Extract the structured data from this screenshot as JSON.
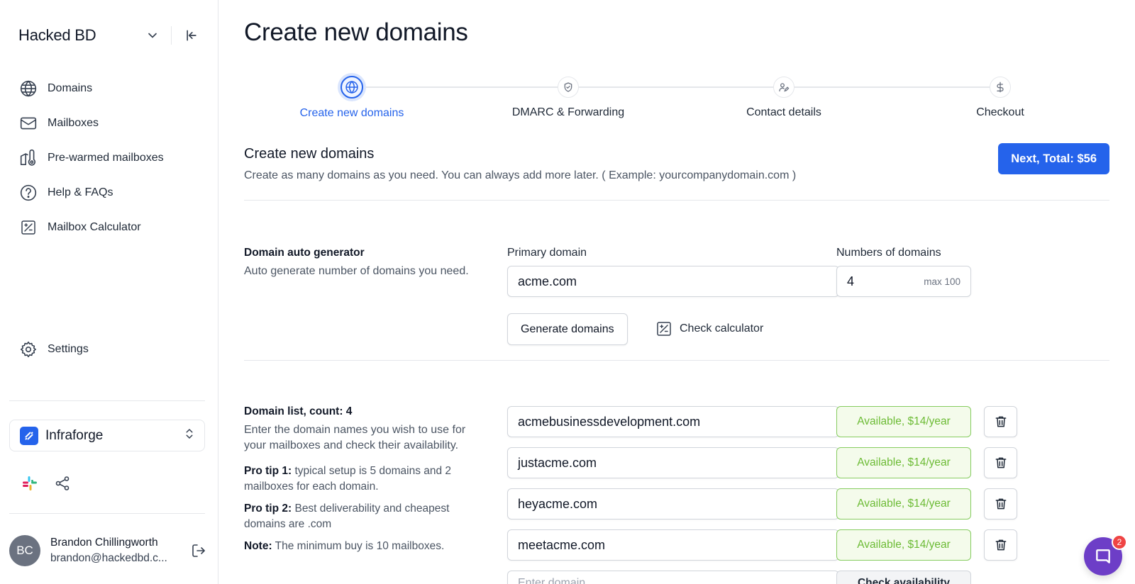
{
  "workspace": {
    "name": "Hacked BD"
  },
  "sidebar": {
    "items": [
      {
        "label": "Domains",
        "icon": "globe-icon"
      },
      {
        "label": "Mailboxes",
        "icon": "envelope-icon"
      },
      {
        "label": "Pre-warmed mailboxes",
        "icon": "thermometer-icon"
      },
      {
        "label": "Help & FAQs",
        "icon": "question-icon"
      },
      {
        "label": "Mailbox Calculator",
        "icon": "calculator-icon"
      }
    ],
    "settings_label": "Settings"
  },
  "org": {
    "name": "Infraforge"
  },
  "user": {
    "initials": "BC",
    "name": "Brandon Chillingworth",
    "email": "brandon@hackedbd.c..."
  },
  "page": {
    "title": "Create new domains"
  },
  "stepper": {
    "steps": [
      {
        "label": "Create new domains",
        "icon": "globe-icon",
        "active": true
      },
      {
        "label": "DMARC & Forwarding",
        "icon": "shield-check-icon",
        "active": false
      },
      {
        "label": "Contact details",
        "icon": "user-edit-icon",
        "active": false
      },
      {
        "label": "Checkout",
        "icon": "dollar-icon",
        "active": false
      }
    ]
  },
  "section": {
    "title": "Create new domains",
    "description": "Create as many domains as you need. You can always add more later. ( Example: yourcompanydomain.com )",
    "next_label": "Next, Total: $56"
  },
  "generator": {
    "title": "Domain auto generator",
    "description": "Auto generate number of domains you need.",
    "primary_label": "Primary domain",
    "primary_value": "acme.com",
    "count_label": "Numbers of domains",
    "count_value": "4",
    "count_suffix": "max 100",
    "generate_label": "Generate domains",
    "calculator_label": "Check calculator"
  },
  "domain_list": {
    "title": "Domain list, count: 4",
    "description": "Enter the domain names you wish to use for your mailboxes and check their availability.",
    "tip1_label": "Pro tip 1:",
    "tip1_text": " typical setup is 5 domains and 2 mailboxes for each domain.",
    "tip2_label": "Pro tip 2:",
    "tip2_text": " Best deliverability and cheapest domains are .com",
    "note_label": "Note:",
    "note_text": " The minimum buy is 10 mailboxes.",
    "rows": [
      {
        "domain": "acmebusinessdevelopment.com",
        "status": "Available, $14/year"
      },
      {
        "domain": "justacme.com",
        "status": "Available, $14/year"
      },
      {
        "domain": "heyacme.com",
        "status": "Available, $14/year"
      },
      {
        "domain": "meetacme.com",
        "status": "Available, $14/year"
      }
    ],
    "new_placeholder": "Enter domain",
    "check_label": "Check availability"
  },
  "chat": {
    "badge": "2"
  },
  "colors": {
    "accent": "#2563eb",
    "success": "#6cbb35",
    "chat": "#6d3ec7"
  }
}
